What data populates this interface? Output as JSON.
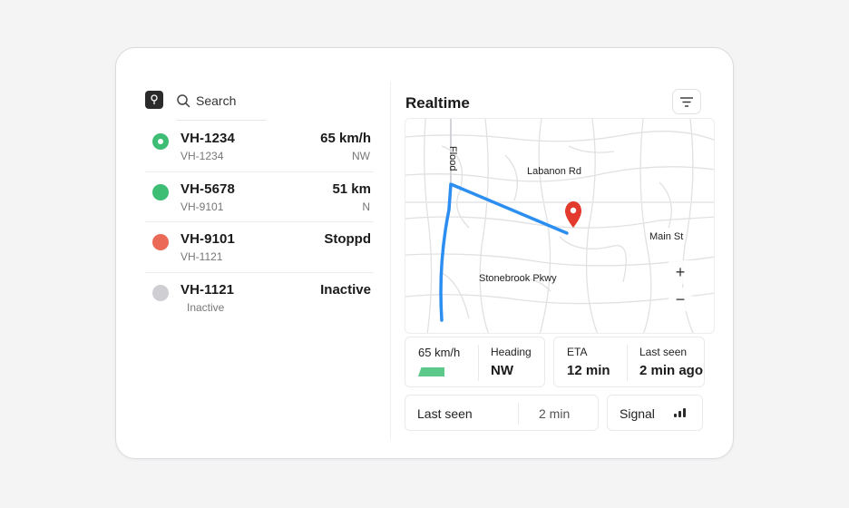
{
  "sidebar": {
    "search_label": "Search",
    "vehicles": [
      {
        "id": "VH-1234",
        "sub": "VH-1234",
        "value": "65 km/h",
        "detail": "NW",
        "status": "moving",
        "color": "#3dbe74"
      },
      {
        "id": "VH-5678",
        "sub": "VH-9101",
        "value": "51 km",
        "detail": "N",
        "status": "moving",
        "color": "#3dbe74"
      },
      {
        "id": "VH-9101",
        "sub": "VH-1121",
        "value": "Stoppd",
        "detail": "",
        "status": "stopped",
        "color": "#ea6a57"
      },
      {
        "id": "VH-1121",
        "sub": "Inactive",
        "value": "Inactive",
        "detail": "",
        "status": "inactive",
        "color": "#cfcfd3"
      }
    ]
  },
  "panel": {
    "title": "Realtime",
    "map": {
      "street_vertical": "Flood",
      "street_1": "Labanon Rd",
      "street_2": "Main St",
      "street_3": "Stonebrook Pkwy",
      "zoom_in": "+",
      "zoom_out": "−",
      "route_color": "#2b8ef0",
      "pin_color": "#e23b2e"
    },
    "stats": {
      "speed": "65 km/h",
      "heading_label": "Heading",
      "heading_value": "NW",
      "eta_label": "ETA",
      "eta_value": "12 min",
      "last_seen_label": "Last seen",
      "last_seen_value": "2 min ago"
    },
    "bottom": {
      "last_seen_label": "Last seen",
      "last_seen_value": "2 min",
      "signal_label": "Signal"
    }
  },
  "colors": {
    "moving": "#3dbe74",
    "stopped": "#ea6a57",
    "inactive": "#cfcfd3",
    "speed_bar": "#5cc98a"
  }
}
